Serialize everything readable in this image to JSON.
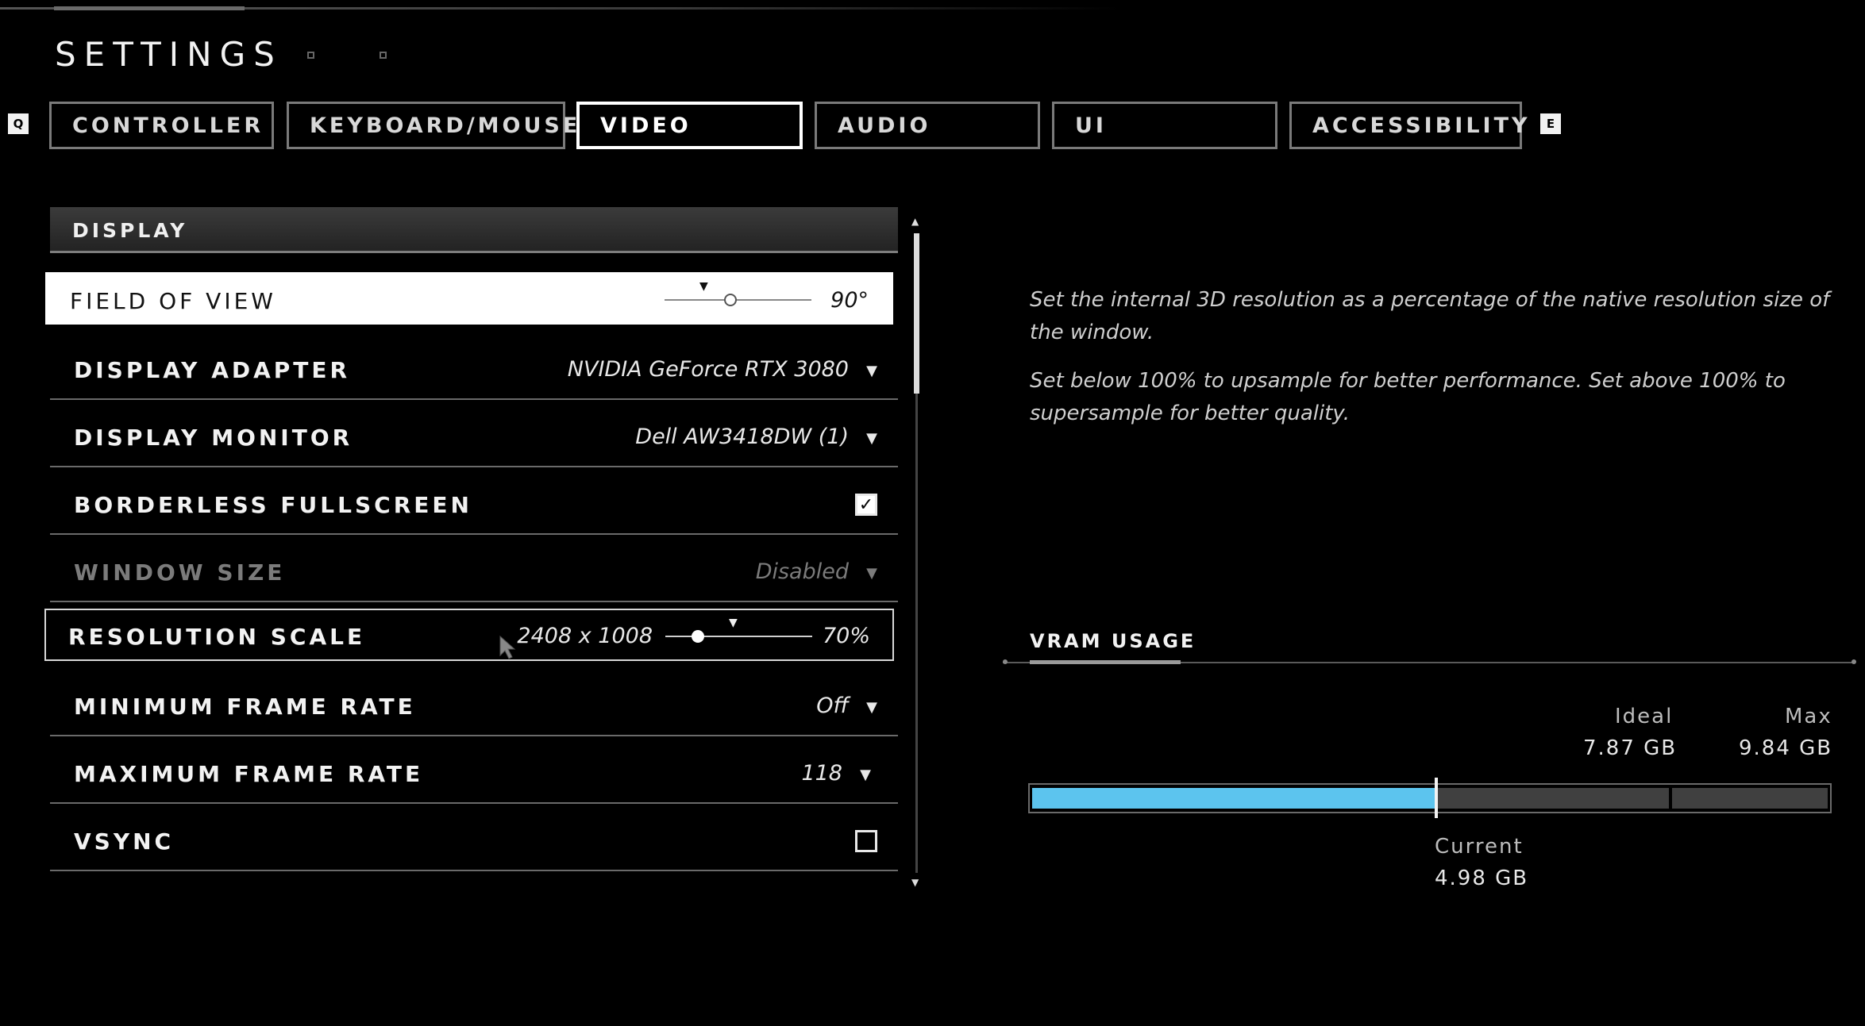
{
  "header": {
    "title": "SETTINGS"
  },
  "tabs": {
    "left_key": "Q",
    "right_key": "E",
    "items": [
      {
        "label": "CONTROLLER"
      },
      {
        "label": "KEYBOARD/MOUSE"
      },
      {
        "label": "VIDEO",
        "active": true
      },
      {
        "label": "AUDIO"
      },
      {
        "label": "UI"
      },
      {
        "label": "ACCESSIBILITY"
      }
    ]
  },
  "section": {
    "title": "DISPLAY"
  },
  "settings": {
    "fov": {
      "label": "FIELD OF VIEW",
      "value": "90°",
      "slider_fraction": 0.45
    },
    "adapter": {
      "label": "DISPLAY ADAPTER",
      "value": "NVIDIA GeForce RTX 3080"
    },
    "monitor": {
      "label": "DISPLAY MONITOR",
      "value": "Dell AW3418DW (1)"
    },
    "borderless": {
      "label": "BORDERLESS FULLSCREEN",
      "checked": true
    },
    "window_size": {
      "label": "WINDOW SIZE",
      "value": "Disabled",
      "disabled": true
    },
    "res_scale": {
      "label": "RESOLUTION SCALE",
      "resolution": "2408 x 1008",
      "value": "70%",
      "slider_fraction": 0.22
    },
    "min_fps": {
      "label": "MINIMUM FRAME RATE",
      "value": "Off"
    },
    "max_fps": {
      "label": "MAXIMUM FRAME RATE",
      "value": "118"
    },
    "vsync": {
      "label": "VSYNC",
      "checked": false
    }
  },
  "description": {
    "line1": "Set the internal 3D resolution as a percentage of the native resolution size of the window.",
    "line2": "Set below 100% to upsample for better performance. Set above 100% to supersample for better quality."
  },
  "vram": {
    "title": "VRAM USAGE",
    "ideal_label": "Ideal",
    "ideal_value": "7.87 GB",
    "max_label": "Max",
    "max_value": "9.84 GB",
    "current_label": "Current",
    "current_value": "4.98 GB",
    "current_fraction": 0.506,
    "bar_color": "#5cc4ee"
  },
  "icons": {
    "caret": "▼",
    "check": "✓"
  }
}
